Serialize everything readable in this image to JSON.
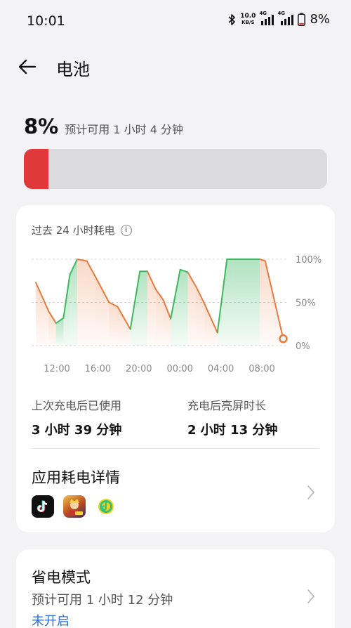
{
  "status_bar": {
    "time": "10:01",
    "net_speed_value": "10.0",
    "net_speed_unit": "KB/S",
    "signal1_label": "4G",
    "signal2_label": "4G",
    "battery_text": "8%"
  },
  "header": {
    "title": "电池",
    "back_icon": "arrow-left-icon"
  },
  "battery": {
    "percent_text": "8%",
    "level": 0.08,
    "estimate": "预计可用 1 小时 4 分钟",
    "fill_color": "#e0393b"
  },
  "usage_card": {
    "title": "过去 24 小时耗电",
    "info_icon": "info-icon",
    "stats": [
      {
        "label": "上次充电后已使用",
        "value": "3 小时 39 分钟"
      },
      {
        "label": "充电后亮屏时长",
        "value": "2 小时 13 分钟"
      }
    ],
    "detail_title": "应用耗电详情",
    "apps": [
      {
        "icon": "tiktok-icon"
      },
      {
        "icon": "honor-of-kings-icon"
      },
      {
        "icon": "qq-music-icon"
      }
    ]
  },
  "chart_data": {
    "type": "line",
    "x_tick_labels": [
      "12:00",
      "16:00",
      "20:00",
      "00:00",
      "04:00",
      "08:00"
    ],
    "y_tick_labels": [
      "100%",
      "50%",
      "0%"
    ],
    "ylim": [
      0,
      100
    ],
    "xlim": [
      0,
      24
    ],
    "grid": true,
    "series": [
      {
        "charging_color": "#3cb861",
        "discharging_color": "#ea7a3d",
        "points": [
          {
            "x": 0.4,
            "y": 73,
            "mode": "discharge"
          },
          {
            "x": 1.6,
            "y": 40,
            "mode": "discharge"
          },
          {
            "x": 2.3,
            "y": 26,
            "mode": "discharge"
          },
          {
            "x": 3.0,
            "y": 32,
            "mode": "charge"
          },
          {
            "x": 3.6,
            "y": 82,
            "mode": "charge"
          },
          {
            "x": 4.3,
            "y": 100,
            "mode": "charge"
          },
          {
            "x": 5.2,
            "y": 98,
            "mode": "discharge"
          },
          {
            "x": 6.0,
            "y": 80,
            "mode": "discharge"
          },
          {
            "x": 7.3,
            "y": 50,
            "mode": "discharge"
          },
          {
            "x": 8.1,
            "y": 45,
            "mode": "discharge"
          },
          {
            "x": 9.3,
            "y": 19,
            "mode": "discharge"
          },
          {
            "x": 10.2,
            "y": 86,
            "mode": "charge"
          },
          {
            "x": 10.9,
            "y": 86,
            "mode": "charge"
          },
          {
            "x": 11.7,
            "y": 65,
            "mode": "discharge"
          },
          {
            "x": 12.4,
            "y": 53,
            "mode": "discharge"
          },
          {
            "x": 13.1,
            "y": 31,
            "mode": "discharge"
          },
          {
            "x": 14.0,
            "y": 88,
            "mode": "charge"
          },
          {
            "x": 14.7,
            "y": 85,
            "mode": "charge"
          },
          {
            "x": 15.5,
            "y": 68,
            "mode": "discharge"
          },
          {
            "x": 16.3,
            "y": 48,
            "mode": "discharge"
          },
          {
            "x": 17.5,
            "y": 15,
            "mode": "discharge"
          },
          {
            "x": 18.4,
            "y": 100,
            "mode": "charge"
          },
          {
            "x": 19.0,
            "y": 100,
            "mode": "charge"
          },
          {
            "x": 21.5,
            "y": 100,
            "mode": "charge"
          },
          {
            "x": 22.0,
            "y": 98,
            "mode": "discharge"
          },
          {
            "x": 23.7,
            "y": 8,
            "mode": "discharge"
          }
        ]
      }
    ]
  },
  "power_saver": {
    "title": "省电模式",
    "estimate": "预计可用 1 小时 12 分钟",
    "status": "未开启"
  }
}
